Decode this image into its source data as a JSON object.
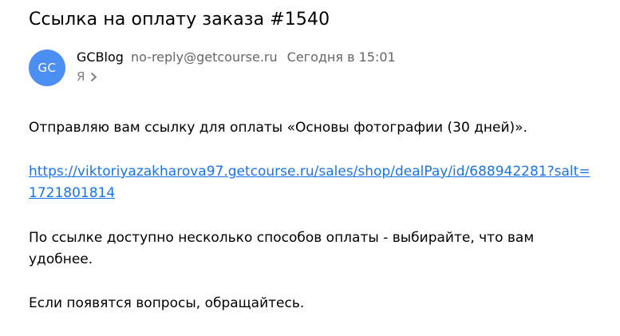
{
  "email": {
    "subject": "Ссылка на оплату заказа #1540",
    "sender": {
      "avatar_initials": "GC",
      "avatar_color": "#4b8ff3",
      "name": "GCBlog",
      "email": "no-reply@getcourse.ru",
      "date": "Сегодня в 15:01"
    },
    "recipient": {
      "label": "Я",
      "icon": "chevron-right-icon"
    },
    "body": {
      "paragraph_1": "Отправляю вам ссылку для оплаты «Основы фотографии (30 дней)».",
      "payment_link": "https://viktoriyazakharova97.getcourse.ru/sales/shop/dealPay/id/688942281?salt=1721801814",
      "paragraph_3": "По ссылке доступно несколько способов оплаты - выбирайте, что вам удобнее.",
      "paragraph_4": "Если появятся вопросы, обращайтесь."
    },
    "link_color": "#1a73e8"
  }
}
